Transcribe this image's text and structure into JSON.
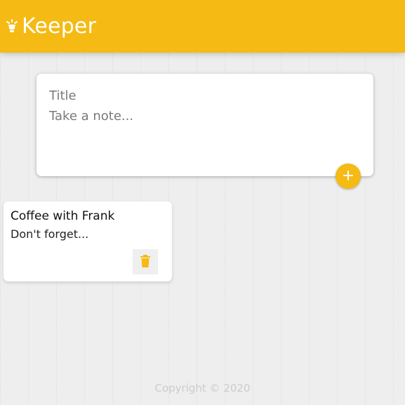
{
  "header": {
    "app_title": "Keeper",
    "logo_icon": "lightbulb-icon"
  },
  "create_area": {
    "title_placeholder": "Title",
    "content_placeholder": "Take a note...",
    "add_icon": "plus-icon"
  },
  "notes": [
    {
      "title": "Coffee with Frank",
      "content": "Don't forget...",
      "delete_icon": "trash-icon"
    }
  ],
  "footer": {
    "copyright": "Copyright © 2020"
  },
  "colors": {
    "accent": "#f5ba13",
    "background": "#eeeeee",
    "card": "#ffffff"
  }
}
